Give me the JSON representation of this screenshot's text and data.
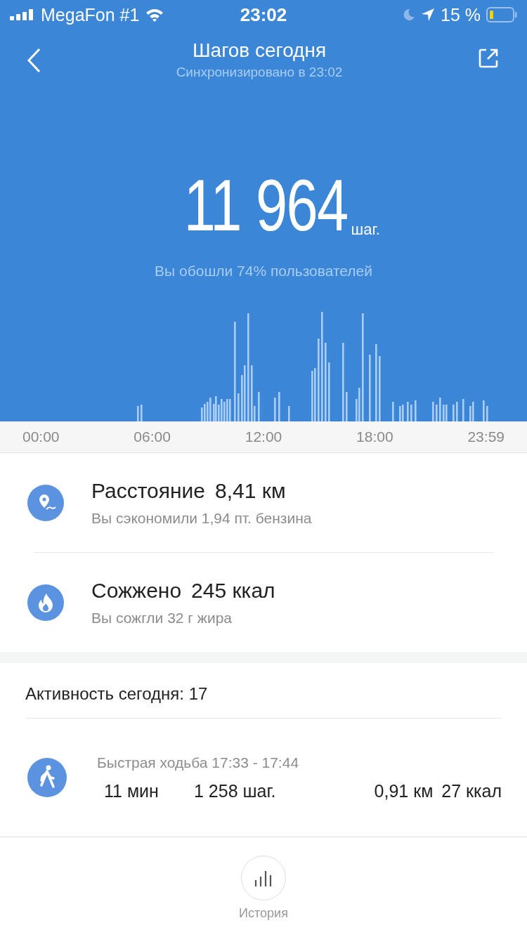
{
  "status_bar": {
    "carrier": "MegaFon #1",
    "time": "23:02",
    "battery_text": "15 %"
  },
  "header": {
    "title": "Шагов сегодня",
    "subtitle": "Синхронизировано в 23:02"
  },
  "steps": {
    "value": "11 964",
    "unit": "шаг.",
    "comparison": "Вы обошли 74% пользователей"
  },
  "chart_axis": [
    "00:00",
    "06:00",
    "12:00",
    "18:00",
    "23:59"
  ],
  "stats": [
    {
      "kind": "distance",
      "title": "Расстояние",
      "value": "8,41 км",
      "note": "Вы сэкономили 1,94 пт. бензина"
    },
    {
      "kind": "calories",
      "title": "Сожжено",
      "value": "245 ккал",
      "note": "Вы сожгли 32 г жира"
    }
  ],
  "activity": {
    "heading": "Активность сегодня: 17",
    "items": [
      {
        "kind": "walk",
        "title": "Быстрая ходьба 17:33 - 17:44",
        "duration": "11 мин",
        "steps": "1 258 шаг.",
        "distance": "0,91 км",
        "calories": "27 ккал"
      }
    ]
  },
  "bottom": {
    "label": "История"
  }
}
